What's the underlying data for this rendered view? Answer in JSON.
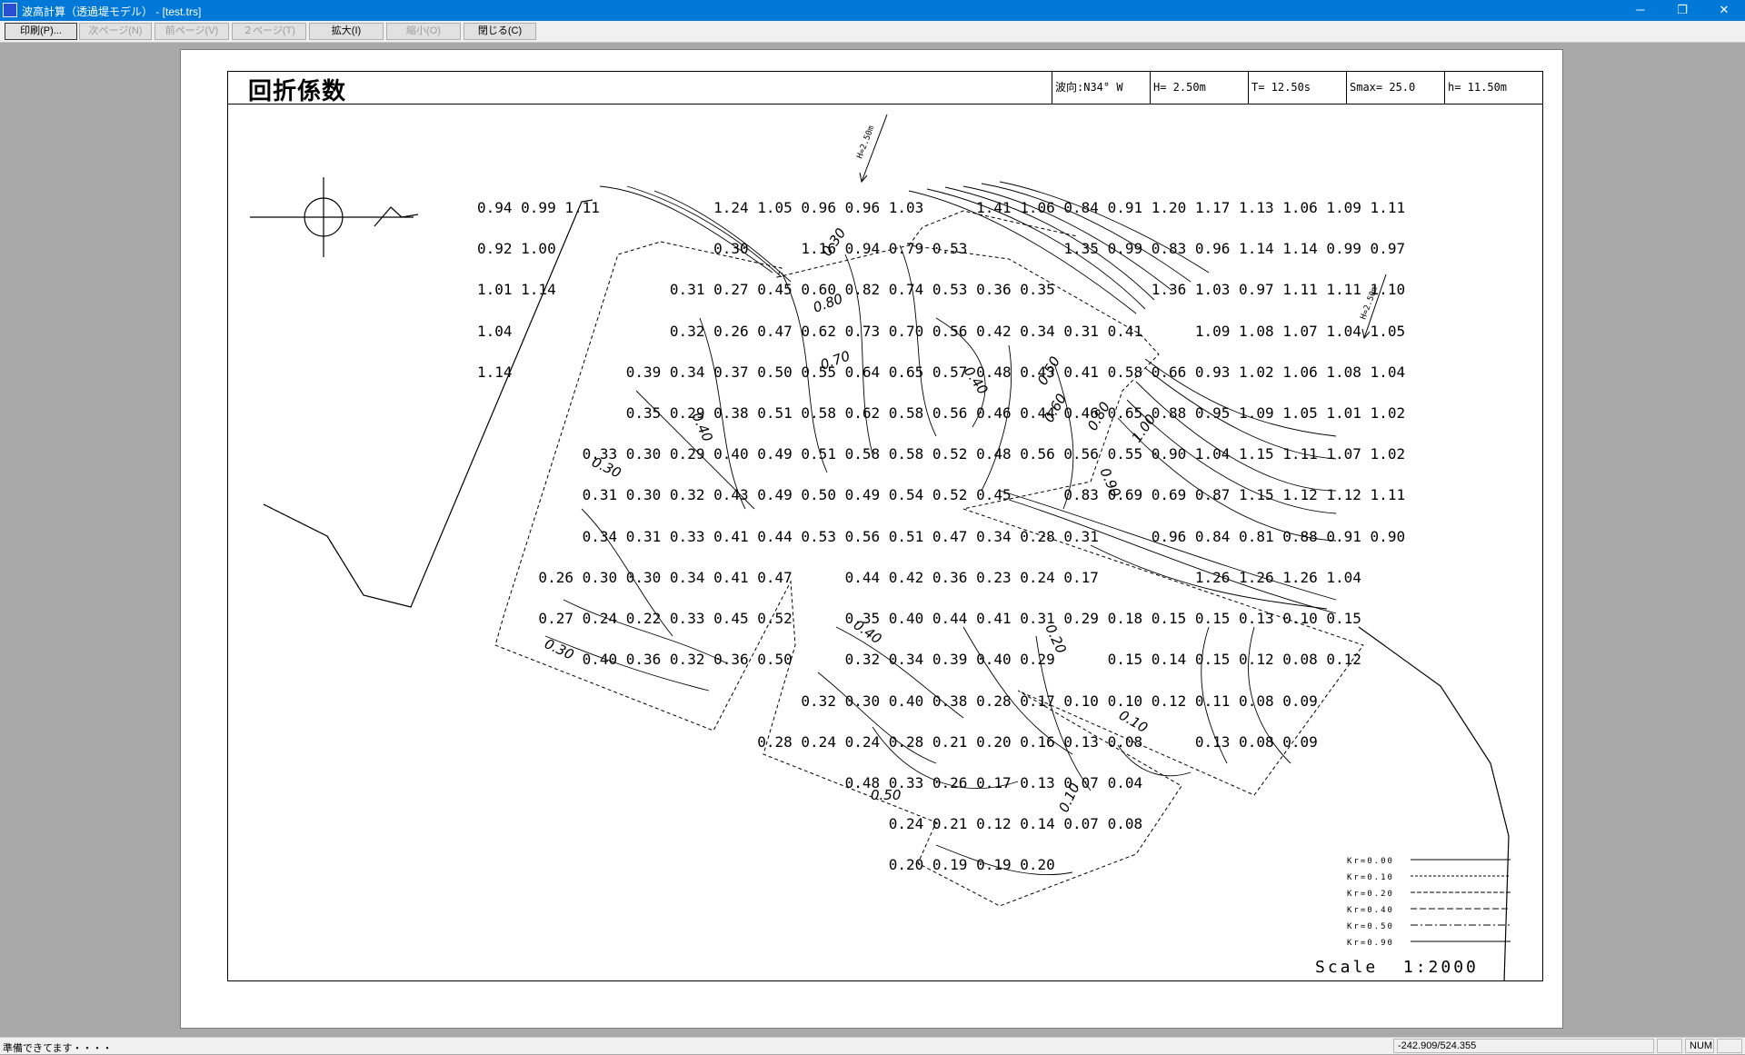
{
  "window": {
    "title": "波高計算（透過堤モデル） - [test.trs]",
    "minimize": "─",
    "restore": "❐",
    "close": "✕"
  },
  "toolbar": {
    "print": "印刷(P)...",
    "next_page": "次ページ(N)",
    "prev_page": "前ページ(V)",
    "two_page": "２ページ(T)",
    "zoom_in": "拡大(I)",
    "zoom_out": "縮小(O)",
    "close": "閉じる(C)"
  },
  "header": {
    "title": "回折係数",
    "direction": "波向:N34° W",
    "height": "H= 2.50m",
    "period": "T= 12.50s",
    "smax": "Smax= 25.0",
    "depth": "h=  11.50m"
  },
  "wave_arrows": [
    "H=2.50m",
    "H=2.50m"
  ],
  "legend": [
    "Kr=0.00",
    "Kr=0.10",
    "Kr=0.20",
    "Kr=0.40",
    "Kr=0.50",
    "Kr=0.90"
  ],
  "scale": "Scale  1:2000",
  "grid_rows": [
    "0.94 0.99 1.11             1.24 1.05 0.96 0.96 1.03      1.41 1.06 0.84 0.91 1.20 1.17 1.13 1.06 1.09 1.11",
    "0.92 1.00                  0.30      1.16 0.94 0.79 0.53           1.35 0.99 0.83 0.96 1.14 1.14 0.99 0.97",
    "1.01 1.14             0.31 0.27 0.45 0.60 0.82 0.74 0.53 0.36 0.35           1.36 1.03 0.97 1.11 1.11 1.10",
    "1.04                  0.32 0.26 0.47 0.62 0.73 0.70 0.56 0.42 0.34 0.31 0.41      1.09 1.08 1.07 1.04 1.05",
    "1.14             0.39 0.34 0.37 0.50 0.55 0.64 0.65 0.57 0.48 0.43 0.41 0.58 0.66 0.93 1.02 1.06 1.08 1.04",
    "                 0.35 0.29 0.38 0.51 0.58 0.62 0.58 0.56 0.46 0.44 0.46 0.65 0.88 0.95 1.09 1.05 1.01 1.02",
    "            0.33 0.30 0.29 0.40 0.49 0.51 0.58 0.58 0.52 0.48 0.56 0.56 0.55 0.90 1.04 1.15 1.11 1.07 1.02",
    "            0.31 0.30 0.32 0.43 0.49 0.50 0.49 0.54 0.52 0.45      0.83 0.69 0.69 0.87 1.15 1.12 1.12 1.11",
    "            0.34 0.31 0.33 0.41 0.44 0.53 0.56 0.51 0.47 0.34 0.28 0.31      0.96 0.84 0.81 0.88 0.91 0.90",
    "       0.26 0.30 0.30 0.34 0.41 0.47      0.44 0.42 0.36 0.23 0.24 0.17           1.26 1.26 1.26 1.04",
    "       0.27 0.24 0.22 0.33 0.45 0.52      0.35 0.40 0.44 0.41 0.31 0.29 0.18 0.15 0.15 0.13 0.10 0.15",
    "            0.40 0.36 0.32 0.36 0.50      0.32 0.34 0.39 0.40 0.29      0.15 0.14 0.15 0.12 0.08 0.12",
    "                                     0.32 0.30 0.40 0.38 0.28 0.17 0.10 0.10 0.12 0.11 0.08 0.09",
    "                                0.28 0.24 0.24 0.28 0.21 0.20 0.16 0.13 0.08      0.13 0.08 0.09",
    "                                          0.48 0.33 0.26 0.17 0.13 0.07 0.04",
    "                                               0.24 0.21 0.12 0.14 0.07 0.08",
    "                                               0.20 0.19 0.19 0.20"
  ],
  "contour_labels": [
    "0.30",
    "0.80",
    "0.70",
    "0.40",
    "0.50",
    "0.60",
    "0.80",
    "1.00",
    "0.90",
    "0.40",
    "0.30",
    "0.20",
    "0.10",
    "0.40",
    "0.30",
    "0.50",
    "0.10"
  ],
  "status": {
    "message": "準備できてます・・・・",
    "coords": "-242.909/524.355",
    "num": "NUM"
  }
}
